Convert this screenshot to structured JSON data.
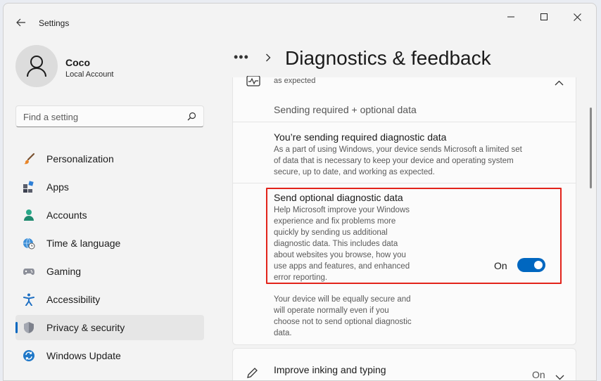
{
  "window": {
    "title": "Settings"
  },
  "user": {
    "name": "Coco",
    "account_type": "Local Account"
  },
  "search": {
    "placeholder": "Find a setting"
  },
  "sidebar": {
    "items": [
      {
        "label": "Personalization",
        "icon": "brush-icon",
        "active": false
      },
      {
        "label": "Apps",
        "icon": "apps-icon",
        "active": false
      },
      {
        "label": "Accounts",
        "icon": "accounts-icon",
        "active": false
      },
      {
        "label": "Time & language",
        "icon": "globe-clock-icon",
        "active": false
      },
      {
        "label": "Gaming",
        "icon": "gamepad-icon",
        "active": false
      },
      {
        "label": "Accessibility",
        "icon": "accessibility-icon",
        "active": false
      },
      {
        "label": "Privacy & security",
        "icon": "shield-icon",
        "active": true
      },
      {
        "label": "Windows Update",
        "icon": "update-icon",
        "active": false
      }
    ]
  },
  "header": {
    "breadcrumb_more": "•••",
    "title": "Diagnostics & feedback"
  },
  "diagnostic": {
    "partial_text": "as expected",
    "status": "Sending required + optional data",
    "required_title": "You’re sending required diagnostic data",
    "required_desc": [
      "As a part of using Windows, your device sends Microsoft a limited set",
      "of data that is necessary to keep your device and operating system",
      "secure, up to date, and working as expected."
    ],
    "optional_title": "Send optional diagnostic data",
    "optional_desc": [
      "Help Microsoft improve your Windows",
      "experience and fix problems more",
      "quickly by sending us additional",
      "diagnostic data. This includes data",
      "about websites you browse, how you",
      "use apps and features, and enhanced",
      "error reporting."
    ],
    "optional_toggle_label": "On",
    "optional_toggle_on": true,
    "note_desc": [
      "Your device will be equally secure and",
      "will operate normally even if you",
      "choose not to send optional diagnostic",
      "data."
    ]
  },
  "inking": {
    "title": "Improve inking and typing",
    "state": "On"
  },
  "colors": {
    "accent": "#0067c0",
    "highlight_border": "#e2231a"
  }
}
